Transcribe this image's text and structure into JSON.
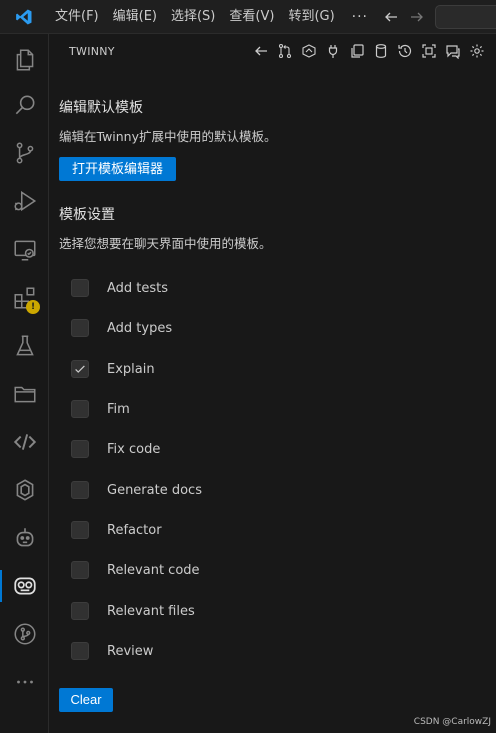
{
  "menu": {
    "items": [
      "文件(F)",
      "编辑(E)",
      "选择(S)",
      "查看(V)",
      "转到(G)"
    ],
    "more": "···"
  },
  "panel": {
    "title": "TWINNY"
  },
  "edit_section": {
    "heading": "编辑默认模板",
    "description": "编辑在Twinny扩展中使用的默认模板。",
    "button_label": "打开模板编辑器"
  },
  "template_section": {
    "heading": "模板设置",
    "description": "选择您想要在聊天界面中使用的模板。",
    "templates": [
      {
        "label": "Add tests",
        "checked": false
      },
      {
        "label": "Add types",
        "checked": false
      },
      {
        "label": "Explain",
        "checked": true
      },
      {
        "label": "Fim",
        "checked": false
      },
      {
        "label": "Fix code",
        "checked": false
      },
      {
        "label": "Generate docs",
        "checked": false
      },
      {
        "label": "Refactor",
        "checked": false
      },
      {
        "label": "Relevant code",
        "checked": false
      },
      {
        "label": "Relevant files",
        "checked": false
      },
      {
        "label": "Review",
        "checked": false
      }
    ],
    "clear_label": "Clear"
  },
  "activity_icons": [
    "explorer-icon",
    "search-icon",
    "source-control-icon",
    "run-debug-icon",
    "remote-explorer-icon",
    "extensions-icon",
    "testing-icon",
    "folder-icon",
    "code-icon",
    "chatgpt-icon",
    "robot-icon",
    "twinny-icon",
    "git-graph-icon",
    "more-icon"
  ],
  "toolbar_icons": [
    "back-icon",
    "pull-request-icon",
    "hub-icon",
    "plug-icon",
    "copy-icon",
    "database-icon",
    "history-icon",
    "fullscreen-icon",
    "new-chat-icon",
    "settings-icon"
  ],
  "colors": {
    "accent": "#0078d4",
    "warning": "#cca700",
    "background": "#181818"
  },
  "watermark": "CSDN @CarlowZJ"
}
